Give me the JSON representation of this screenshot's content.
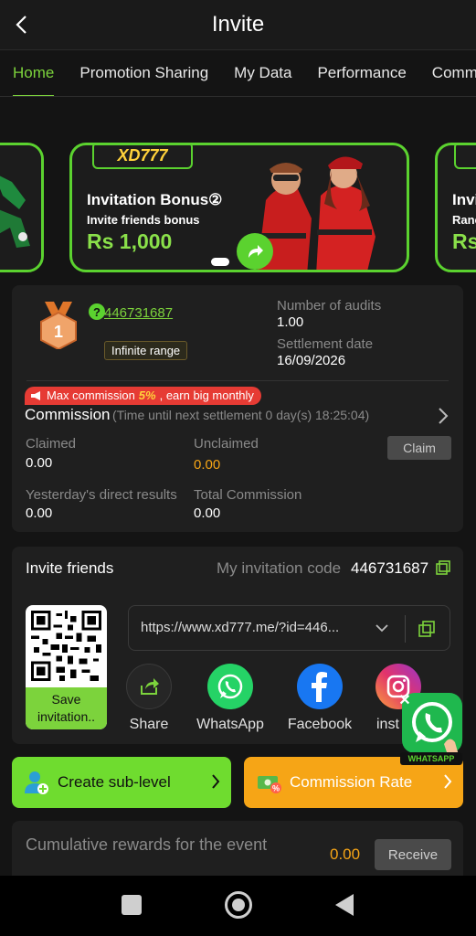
{
  "header": {
    "title": "Invite",
    "back_icon": "chevron-left-icon"
  },
  "tabs": [
    {
      "label": "Home",
      "active": true
    },
    {
      "label": "Promotion Sharing"
    },
    {
      "label": "My Data"
    },
    {
      "label": "Performance"
    },
    {
      "label": "Commission"
    }
  ],
  "banner": {
    "logo": "XD777",
    "title": "Invitation Bonus②",
    "subtitle": "Invite friends bonus",
    "amount": "Rs 1,000",
    "side_right_title": "Invi",
    "side_right_sub": "Ranc",
    "side_right_amount": "Rs"
  },
  "stats": {
    "user_id": "446731687",
    "range_badge": "Infinite range",
    "audits_label": "Number of audits",
    "audits_value": "1.00",
    "settlement_label": "Settlement date",
    "settlement_value": "16/09/2026",
    "promo_prefix": "Max commission ",
    "promo_highlight": "5%",
    "promo_suffix": ", earn big monthly",
    "commission_title": "Commission",
    "commission_note": "(Time until next settlement  0 day(s) 18:25:04)",
    "claimed_label": "Claimed",
    "claimed_value": "0.00",
    "unclaimed_label": "Unclaimed",
    "unclaimed_value": "0.00",
    "claim_button": "Claim",
    "yesterday_label": "Yesterday's direct results",
    "yesterday_value": "0.00",
    "total_label": "Total Commission",
    "total_value": "0.00"
  },
  "invite": {
    "title": "Invite friends",
    "code_label": "My invitation code",
    "code_value": "446731687",
    "save_button": "Save invitation..",
    "link": "https://www.xd777.me/?id=446...",
    "share_items": [
      {
        "label": "Share",
        "icon": "share-icon"
      },
      {
        "label": "WhatsApp",
        "icon": "whatsapp-icon"
      },
      {
        "label": "Facebook",
        "icon": "facebook-icon"
      },
      {
        "label": "inst",
        "icon": "instagram-icon"
      }
    ]
  },
  "actions": {
    "create_label": "Create sub-level",
    "rate_label": "Commission Rate"
  },
  "rewards": {
    "label": "Cumulative rewards for the event",
    "value": "0.00",
    "receive_button": "Receive"
  },
  "floating": {
    "label": "WHATSAPP"
  },
  "colors": {
    "accent": "#7cd33c",
    "orange": "#f6a516",
    "background": "#141414",
    "card": "#1f1f1f"
  }
}
